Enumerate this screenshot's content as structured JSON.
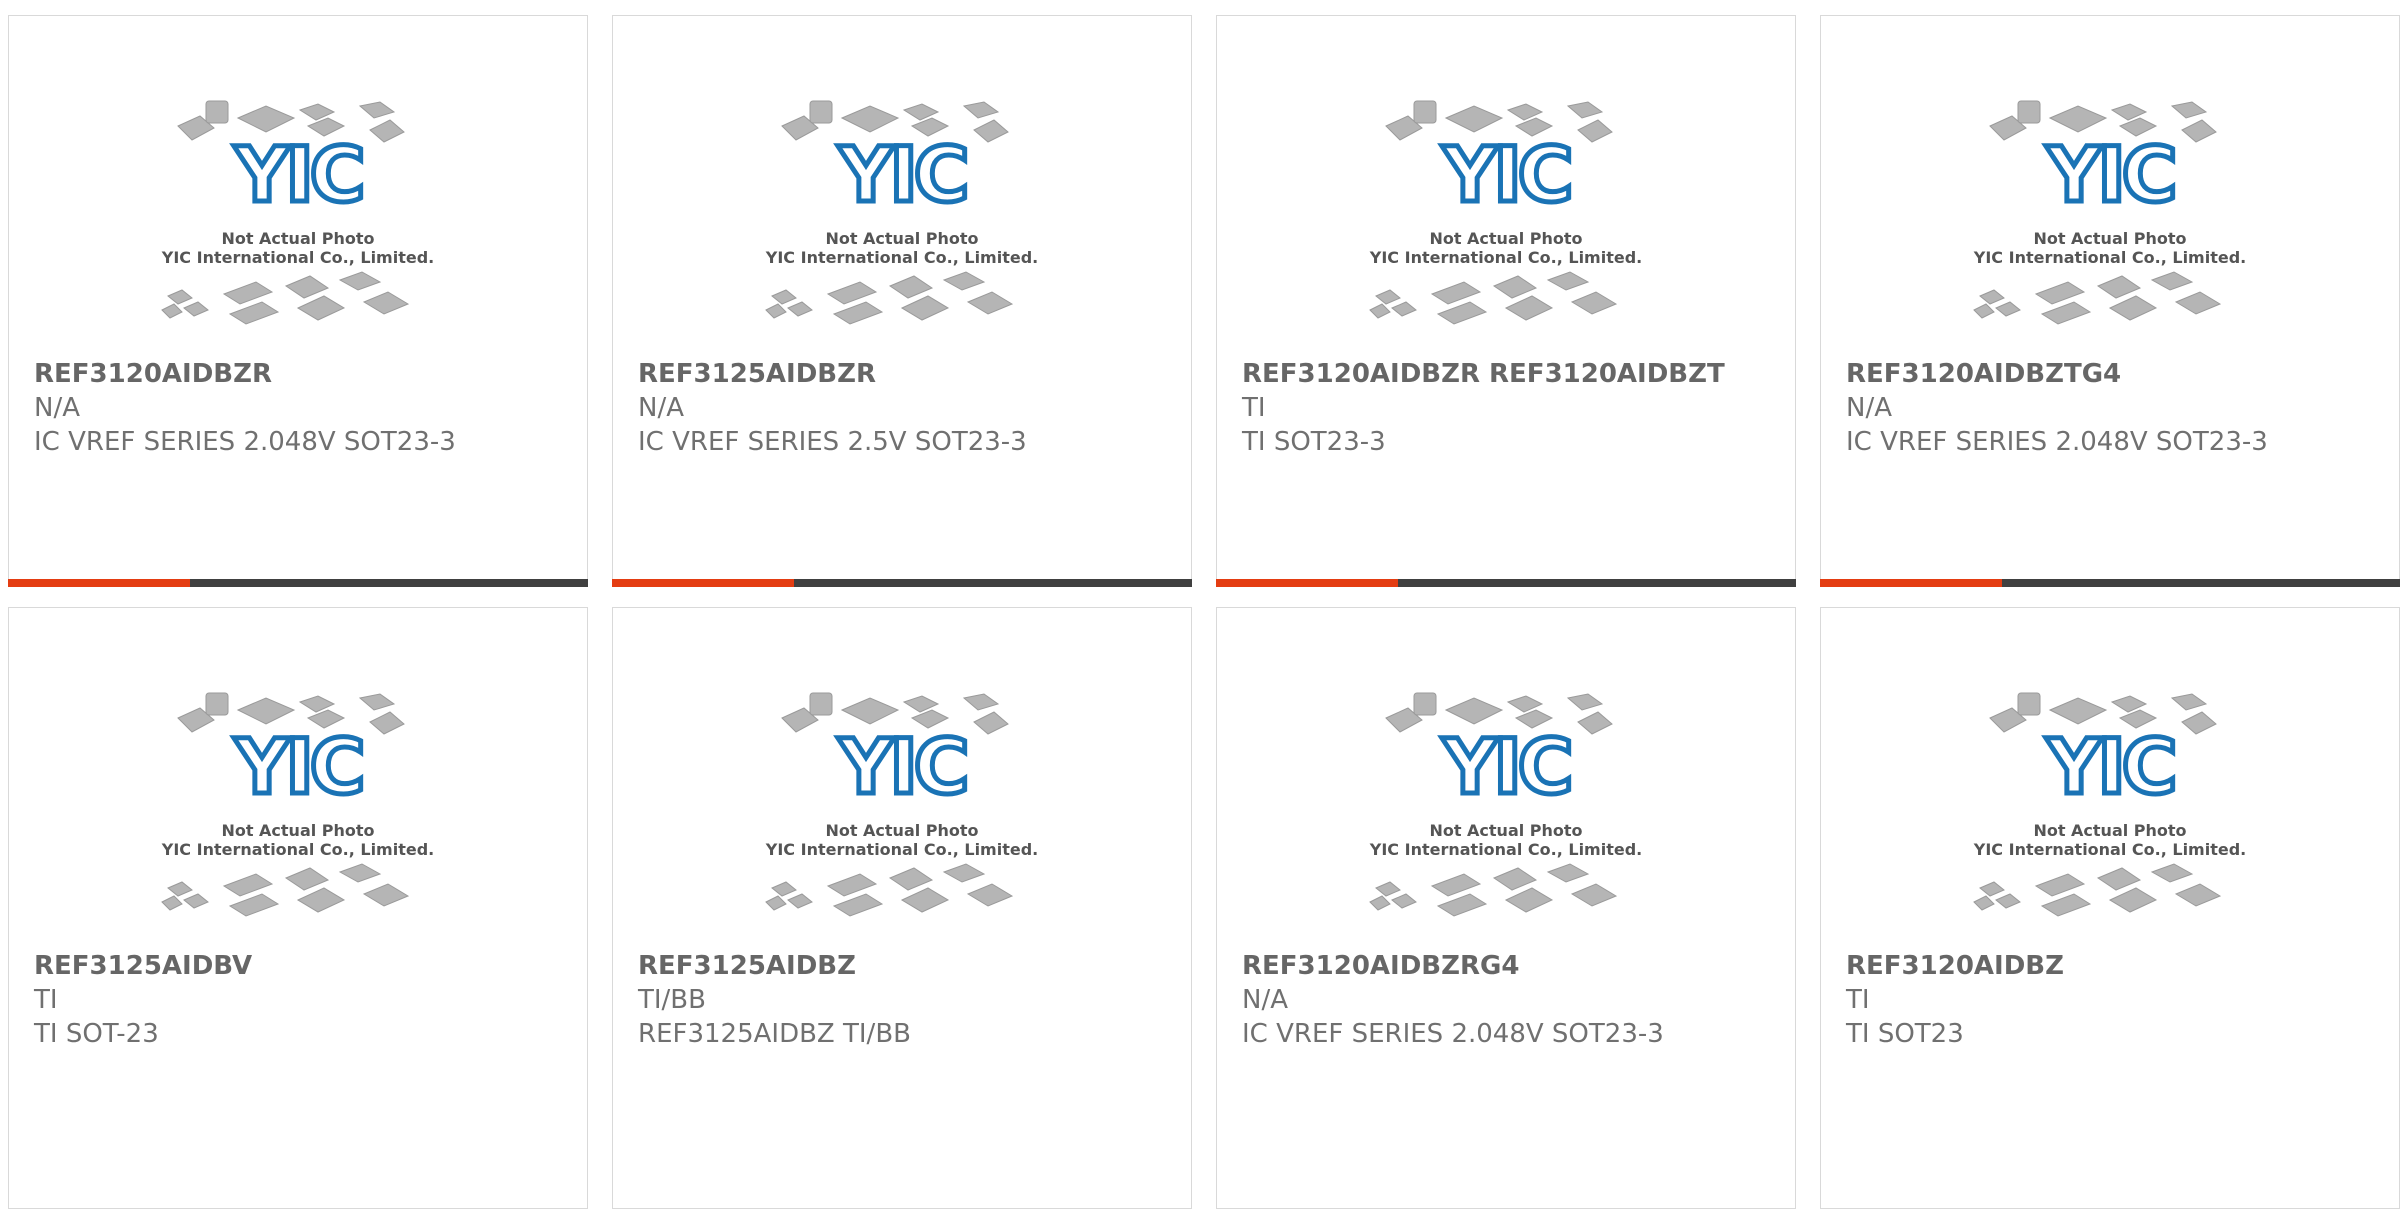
{
  "photo_caption": {
    "line1": "Not Actual Photo",
    "line2": "YIC International Co., Limited."
  },
  "logo_text": "YIC",
  "colors": {
    "accent": "#e43d12",
    "bar": "#404040",
    "logo": "#1a73b5",
    "text": "#707070"
  },
  "products": [
    {
      "part_number": "REF3120AIDBZR",
      "manufacturer": "N/A",
      "description": "IC VREF SERIES 2.048V SOT23-3"
    },
    {
      "part_number": "REF3125AIDBZR",
      "manufacturer": "N/A",
      "description": "IC VREF SERIES 2.5V SOT23-3"
    },
    {
      "part_number": "REF3120AIDBZR REF3120AIDBZT",
      "manufacturer": "TI",
      "description": "TI SOT23-3"
    },
    {
      "part_number": "REF3120AIDBZTG4",
      "manufacturer": "N/A",
      "description": "IC VREF SERIES 2.048V SOT23-3"
    },
    {
      "part_number": "REF3125AIDBV",
      "manufacturer": "TI",
      "description": "TI SOT-23"
    },
    {
      "part_number": "REF3125AIDBZ",
      "manufacturer": "TI/BB",
      "description": "REF3125AIDBZ TI/BB"
    },
    {
      "part_number": "REF3120AIDBZRG4",
      "manufacturer": "N/A",
      "description": "IC VREF SERIES 2.048V SOT23-3"
    },
    {
      "part_number": "REF3120AIDBZ",
      "manufacturer": "TI",
      "description": "TI SOT23"
    }
  ]
}
